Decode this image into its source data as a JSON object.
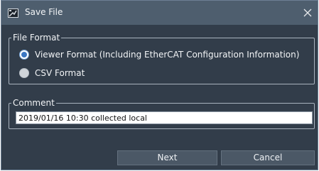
{
  "dialog": {
    "title": "Save File",
    "title_icon": "save-file-icon",
    "close_icon": "close-icon"
  },
  "file_format": {
    "legend": "File Format",
    "options": [
      {
        "label": "Viewer Format (Including EtherCAT Configuration Information)",
        "selected": true
      },
      {
        "label": "CSV Format",
        "selected": false
      }
    ]
  },
  "comment": {
    "legend": "Comment",
    "value": "2019/01/16 10:30 collected local"
  },
  "buttons": {
    "next_label": "Next",
    "cancel_label": "Cancel"
  },
  "colors": {
    "window_bg": "#323d4a",
    "titlebar_bg": "#4e5e6e",
    "radio_selected": "#3a77c4"
  }
}
